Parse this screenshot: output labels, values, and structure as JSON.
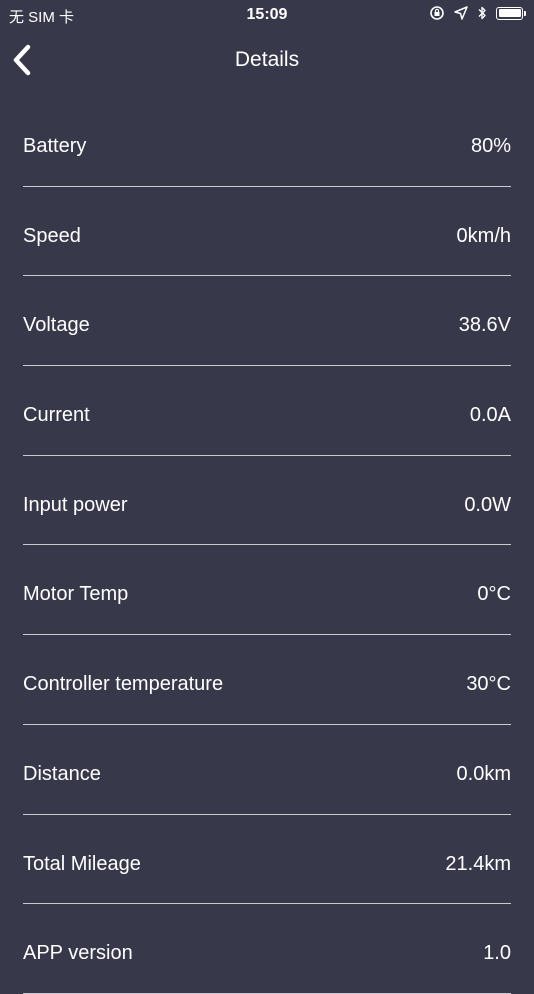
{
  "status_bar": {
    "carrier": "无 SIM 卡",
    "time": "15:09"
  },
  "nav": {
    "title": "Details",
    "back_icon": "chevron-left-icon"
  },
  "rows": [
    {
      "label": "Battery",
      "value": "80%"
    },
    {
      "label": "Speed",
      "value": "0km/h"
    },
    {
      "label": "Voltage",
      "value": "38.6V"
    },
    {
      "label": "Current",
      "value": "0.0A"
    },
    {
      "label": "Input power",
      "value": "0.0W"
    },
    {
      "label": "Motor Temp",
      "value": "0°C"
    },
    {
      "label": "Controller temperature",
      "value": "30°C"
    },
    {
      "label": "Distance",
      "value": "0.0km"
    },
    {
      "label": "Total Mileage",
      "value": "21.4km"
    },
    {
      "label": "APP version",
      "value": "1.0"
    }
  ],
  "colors": {
    "background": "#373849",
    "text": "#ffffff",
    "divider": "#c9c9cf"
  }
}
